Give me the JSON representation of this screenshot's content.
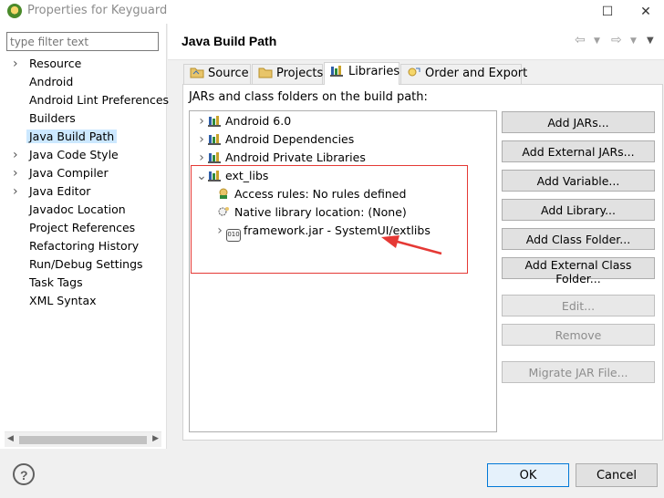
{
  "window": {
    "title": "Properties for Keyguard",
    "minimize_glyph": "☐",
    "close_glyph": "✕"
  },
  "filter": {
    "placeholder": "type filter text"
  },
  "nav": {
    "items": [
      {
        "label": "Resource",
        "expandable": true
      },
      {
        "label": "Android",
        "expandable": false
      },
      {
        "label": "Android Lint Preferences",
        "expandable": false
      },
      {
        "label": "Builders",
        "expandable": false
      },
      {
        "label": "Java Build Path",
        "expandable": false,
        "selected": true
      },
      {
        "label": "Java Code Style",
        "expandable": true
      },
      {
        "label": "Java Compiler",
        "expandable": true
      },
      {
        "label": "Java Editor",
        "expandable": true
      },
      {
        "label": "Javadoc Location",
        "expandable": false
      },
      {
        "label": "Project References",
        "expandable": false
      },
      {
        "label": "Refactoring History",
        "expandable": false
      },
      {
        "label": "Run/Debug Settings",
        "expandable": false
      },
      {
        "label": "Task Tags",
        "expandable": false
      },
      {
        "label": "XML Syntax",
        "expandable": false
      }
    ]
  },
  "page": {
    "title": "Java Build Path"
  },
  "tabs": [
    {
      "label": "Source",
      "icon": "source-folder-icon"
    },
    {
      "label": "Projects",
      "icon": "projects-icon"
    },
    {
      "label": "Libraries",
      "icon": "libraries-icon",
      "active": true
    },
    {
      "label": "Order and Export",
      "icon": "order-export-icon"
    }
  ],
  "libraries": {
    "label": "JARs and class folders on the build path:",
    "tree": [
      {
        "label": "Android 6.0",
        "icon": "library-icon",
        "expanded": false
      },
      {
        "label": "Android Dependencies",
        "icon": "library-icon",
        "expanded": false
      },
      {
        "label": "Android Private Libraries",
        "icon": "library-icon",
        "expanded": false
      },
      {
        "label": "ext_libs",
        "icon": "library-icon",
        "expanded": true
      },
      {
        "label": "Access rules: No rules defined",
        "icon": "access-rules-icon",
        "child": true
      },
      {
        "label": "Native library location: (None)",
        "icon": "native-library-icon",
        "child": true
      },
      {
        "label": "framework.jar - SystemUI/extlibs",
        "icon": "jar-icon",
        "child": true,
        "expandable": true
      }
    ],
    "buttons": [
      {
        "label": "Add JARs...",
        "enabled": true
      },
      {
        "label": "Add External JARs...",
        "enabled": true
      },
      {
        "label": "Add Variable...",
        "enabled": true
      },
      {
        "label": "Add Library...",
        "enabled": true
      },
      {
        "label": "Add Class Folder...",
        "enabled": true
      },
      {
        "label": "Add External Class Folder...",
        "enabled": true
      },
      {
        "label": "Edit...",
        "enabled": false
      },
      {
        "label": "Remove",
        "enabled": false
      },
      {
        "label": "Migrate JAR File...",
        "enabled": false
      }
    ]
  },
  "footer": {
    "help": "?",
    "ok": "OK",
    "cancel": "Cancel"
  },
  "colors": {
    "highlight": "#e53935",
    "selected": "#cce8ff",
    "accent": "#0078d7"
  }
}
